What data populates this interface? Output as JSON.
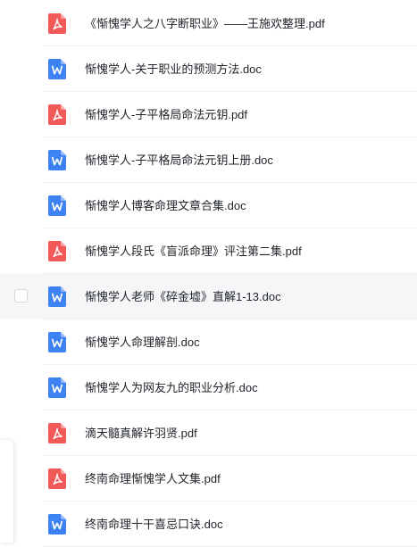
{
  "colors": {
    "pdf_icon": "#f25a5a",
    "doc_icon": "#3d82f2",
    "row_highlight": "#f5f6f8",
    "text": "#1f2329"
  },
  "files": [
    {
      "name": "《惭愧学人之八字断职业》——王施欢整理.pdf",
      "type": "pdf",
      "icon": "pdf-icon"
    },
    {
      "name": "惭愧学人-关于职业的预测方法.doc",
      "type": "doc",
      "icon": "word-doc-icon"
    },
    {
      "name": "惭愧学人-子平格局命法元钥.pdf",
      "type": "pdf",
      "icon": "pdf-icon"
    },
    {
      "name": "惭愧学人-子平格局命法元钥上册.doc",
      "type": "doc",
      "icon": "word-doc-icon"
    },
    {
      "name": "惭愧学人博客命理文章合集.doc",
      "type": "doc",
      "icon": "word-doc-icon"
    },
    {
      "name": "惭愧学人段氏《盲派命理》评注第二集.pdf",
      "type": "pdf",
      "icon": "pdf-icon"
    },
    {
      "name": "惭愧学人老师《碎金墟》直解1-13.doc",
      "type": "doc",
      "icon": "word-doc-icon",
      "hovered": true
    },
    {
      "name": "惭愧学人命理解剖.doc",
      "type": "doc",
      "icon": "word-doc-icon"
    },
    {
      "name": "惭愧学人为网友九的职业分析.doc",
      "type": "doc",
      "icon": "word-doc-icon"
    },
    {
      "name": "滴天髓真解许羽贤.pdf",
      "type": "pdf",
      "icon": "pdf-icon"
    },
    {
      "name": "终南命理惭愧学人文集.pdf",
      "type": "pdf",
      "icon": "pdf-icon"
    },
    {
      "name": "终南命理十干喜忌口诀.doc",
      "type": "doc",
      "icon": "word-doc-icon"
    }
  ]
}
